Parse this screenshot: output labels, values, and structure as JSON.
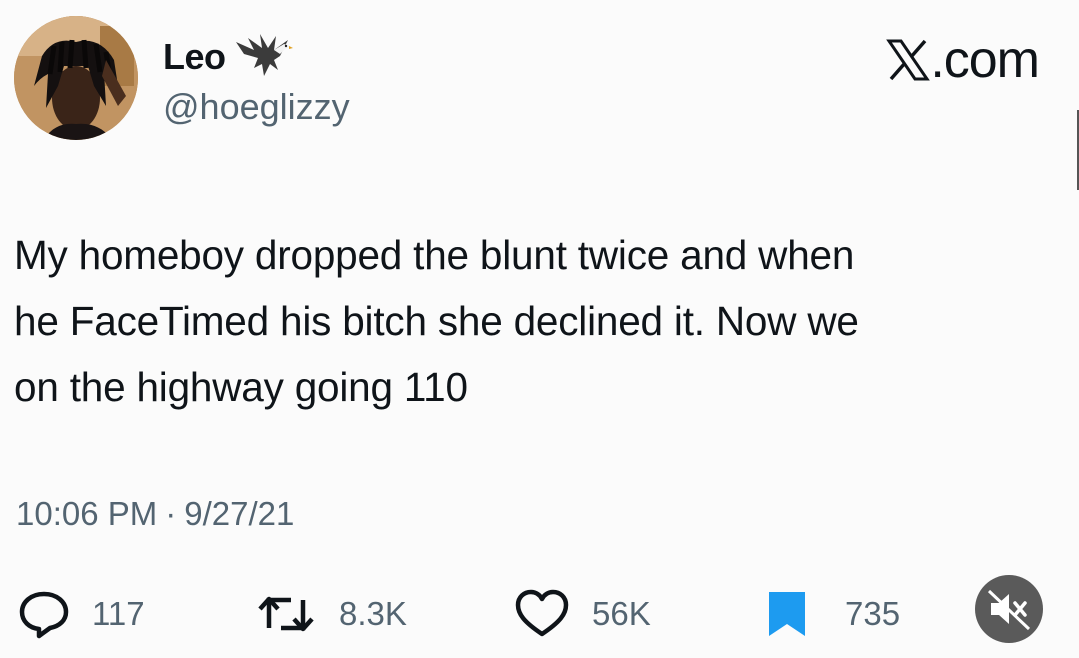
{
  "author": {
    "display_name": "Leo",
    "handle": "@hoeglizzy",
    "name_emoji_icon": "eagle-icon"
  },
  "brand": {
    "label": ".com",
    "icon": "x-logo-icon"
  },
  "tweet": {
    "lines": [
      "My homeboy dropped the blunt twice and when",
      "he FaceTimed his bitch she declined it. Now we",
      "on the highway going 110"
    ]
  },
  "meta": {
    "time": "10:06 PM",
    "separator": "·",
    "date": "9/27/21"
  },
  "actions": {
    "replies": {
      "icon": "reply-icon",
      "count": "117"
    },
    "retweets": {
      "icon": "retweet-icon",
      "count": "8.3K"
    },
    "likes": {
      "icon": "heart-icon",
      "count": "56K"
    },
    "bookmarks": {
      "icon": "bookmark-icon",
      "count": "735"
    }
  },
  "overlay": {
    "mute_icon": "speaker-muted-icon"
  },
  "colors": {
    "text": "#0f1419",
    "secondary": "#536471",
    "bookmark_blue": "#1d9bf0",
    "background": "#fbfbfb"
  }
}
